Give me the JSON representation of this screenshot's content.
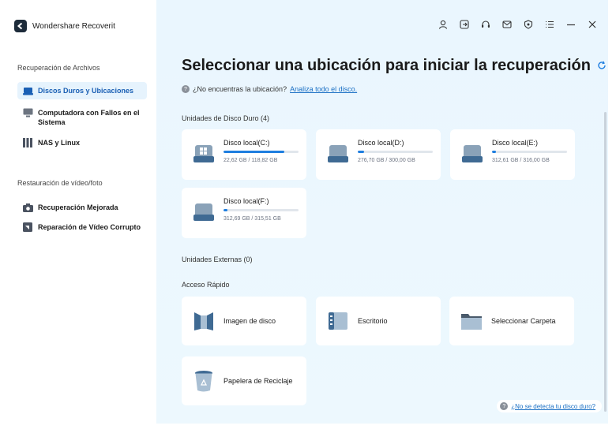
{
  "app": {
    "name": "Wondershare Recoverit"
  },
  "sidebar": {
    "sections": [
      {
        "label": "Recuperación de Archivos",
        "items": [
          {
            "label": "Discos Duros y Ubicaciones",
            "icon": "hard-drive-icon",
            "active": true
          },
          {
            "label": "Computadora con Fallos en el Sistema",
            "icon": "monitor-icon"
          },
          {
            "label": "NAS y Linux",
            "icon": "nas-icon"
          }
        ]
      },
      {
        "label": "Restauración de vídeo/foto",
        "items": [
          {
            "label": "Recuperación Mejorada",
            "icon": "camera-icon"
          },
          {
            "label": "Reparación de Vídeo Corrupto",
            "icon": "video-repair-icon"
          }
        ]
      }
    ]
  },
  "main": {
    "title": "Seleccionar una ubicación para iniciar la recuperación",
    "help_text": "¿No encuentras la ubicación?",
    "help_link": "Analiza todo el disco.",
    "hard_drives_label": "Unidades de Disco Duro (4)",
    "drives": [
      {
        "name": "Disco local(C:)",
        "size": "22,62 GB / 118,82 GB",
        "fill": 0.81,
        "windows": true
      },
      {
        "name": "Disco local(D:)",
        "size": "276,70 GB / 300,00 GB",
        "fill": 0.08
      },
      {
        "name": "Disco local(E:)",
        "size": "312,61 GB / 316,00 GB",
        "fill": 0.05
      },
      {
        "name": "Disco local(F:)",
        "size": "312,69 GB / 315,51 GB",
        "fill": 0.05
      }
    ],
    "external_label": "Unidades Externas (0)",
    "quick_label": "Acceso Rápido",
    "quick_access": [
      {
        "label": "Imagen de disco",
        "icon": "disk-image-icon"
      },
      {
        "label": "Escritorio",
        "icon": "desktop-icon"
      },
      {
        "label": "Seleccionar Carpeta",
        "icon": "folder-icon"
      },
      {
        "label": "Papelera de Reciclaje",
        "icon": "recycle-bin-icon"
      }
    ],
    "bottom_help": "¿No se detecta tu disco duro?"
  },
  "colors": {
    "accent": "#1e7ee0",
    "link": "#1a6fc4",
    "main_bg": "#eaf6fe"
  }
}
